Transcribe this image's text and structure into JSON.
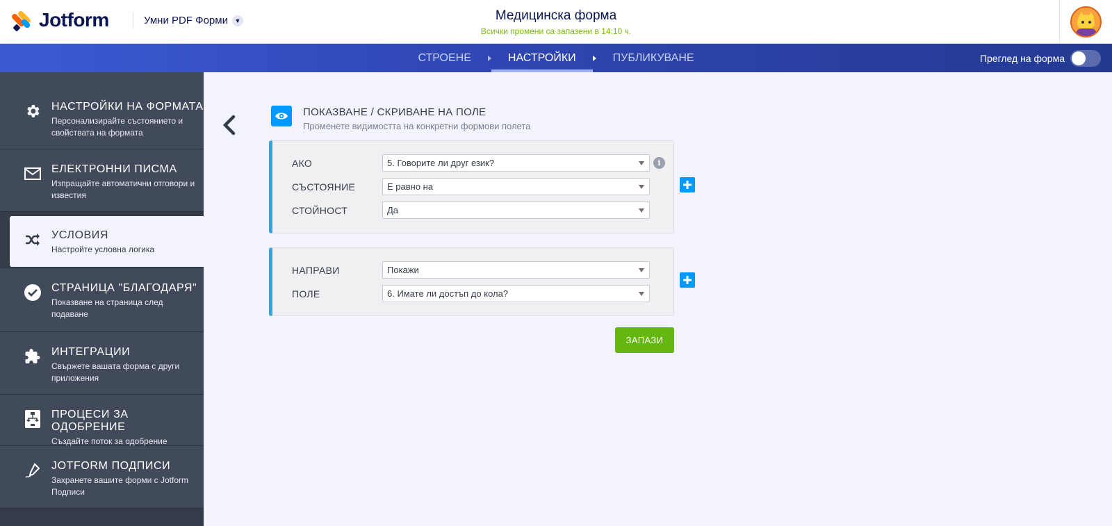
{
  "header": {
    "logo_text": "Jotform",
    "product_switch": "Умни PDF Форми",
    "form_title": "Медицинска форма",
    "save_status": "Всички промени са запазени в 14:10 ч."
  },
  "nav": {
    "steps": [
      {
        "label": "СТРОЕНЕ",
        "active": false
      },
      {
        "label": "НАСТРОЙКИ",
        "active": true
      },
      {
        "label": "ПУБЛИКУВАНЕ",
        "active": false
      }
    ],
    "preview_label": "Преглед на форма",
    "preview_on": false
  },
  "sidebar": {
    "items": [
      {
        "title": "НАСТРОЙКИ НА ФОРМАТА",
        "desc": "Персонализирайте състоянието и свойствата на формата",
        "icon": "gear-icon"
      },
      {
        "title": "ЕЛЕКТРОННИ ПИСМА",
        "desc": "Изпращайте автоматични отговори и известия",
        "icon": "envelope-icon"
      },
      {
        "title": "УСЛОВИЯ",
        "desc": "Настройте условна логика",
        "icon": "shuffle-icon",
        "active": true
      },
      {
        "title": "СТРАНИЦА \"БЛАГОДАРЯ\"",
        "desc": "Показване на страница след подаване",
        "icon": "check-circle-icon"
      },
      {
        "title": "ИНТЕГРАЦИИ",
        "desc": "Свържете вашата форма с други приложения",
        "icon": "puzzle-icon"
      },
      {
        "title": "ПРОЦЕСИ ЗА ОДОБРЕНИЕ",
        "desc": "Създайте поток за одобрение",
        "icon": "flowchart-icon"
      },
      {
        "title": "JOTFORM ПОДПИСИ",
        "desc": "Захранете вашите форми с Jotform Подписи",
        "icon": "pen-icon"
      }
    ]
  },
  "condition": {
    "title": "ПОКАЗВАНЕ / СКРИВАНЕ НА ПОЛЕ",
    "desc": "Променете видимостта на конкретни формови полета",
    "if_block": {
      "if_label": "АКО",
      "if_value": "5. Говорите ли друг език?",
      "state_label": "СЪСТОЯНИЕ",
      "state_value": "Е равно на",
      "value_label": "СТОЙНОСТ",
      "value_value": "Да"
    },
    "do_block": {
      "do_label": "НАПРАВИ",
      "do_value": "Покажи",
      "field_label": "ПОЛЕ",
      "field_value": "6. Имате ли достъп до кола?"
    },
    "save_label": "ЗАПАЗИ"
  },
  "colors": {
    "accent_blue": "#0099ff",
    "save_green": "#64b70f",
    "status_green": "#78bb07",
    "sidebar_bg": "#414a5a"
  }
}
